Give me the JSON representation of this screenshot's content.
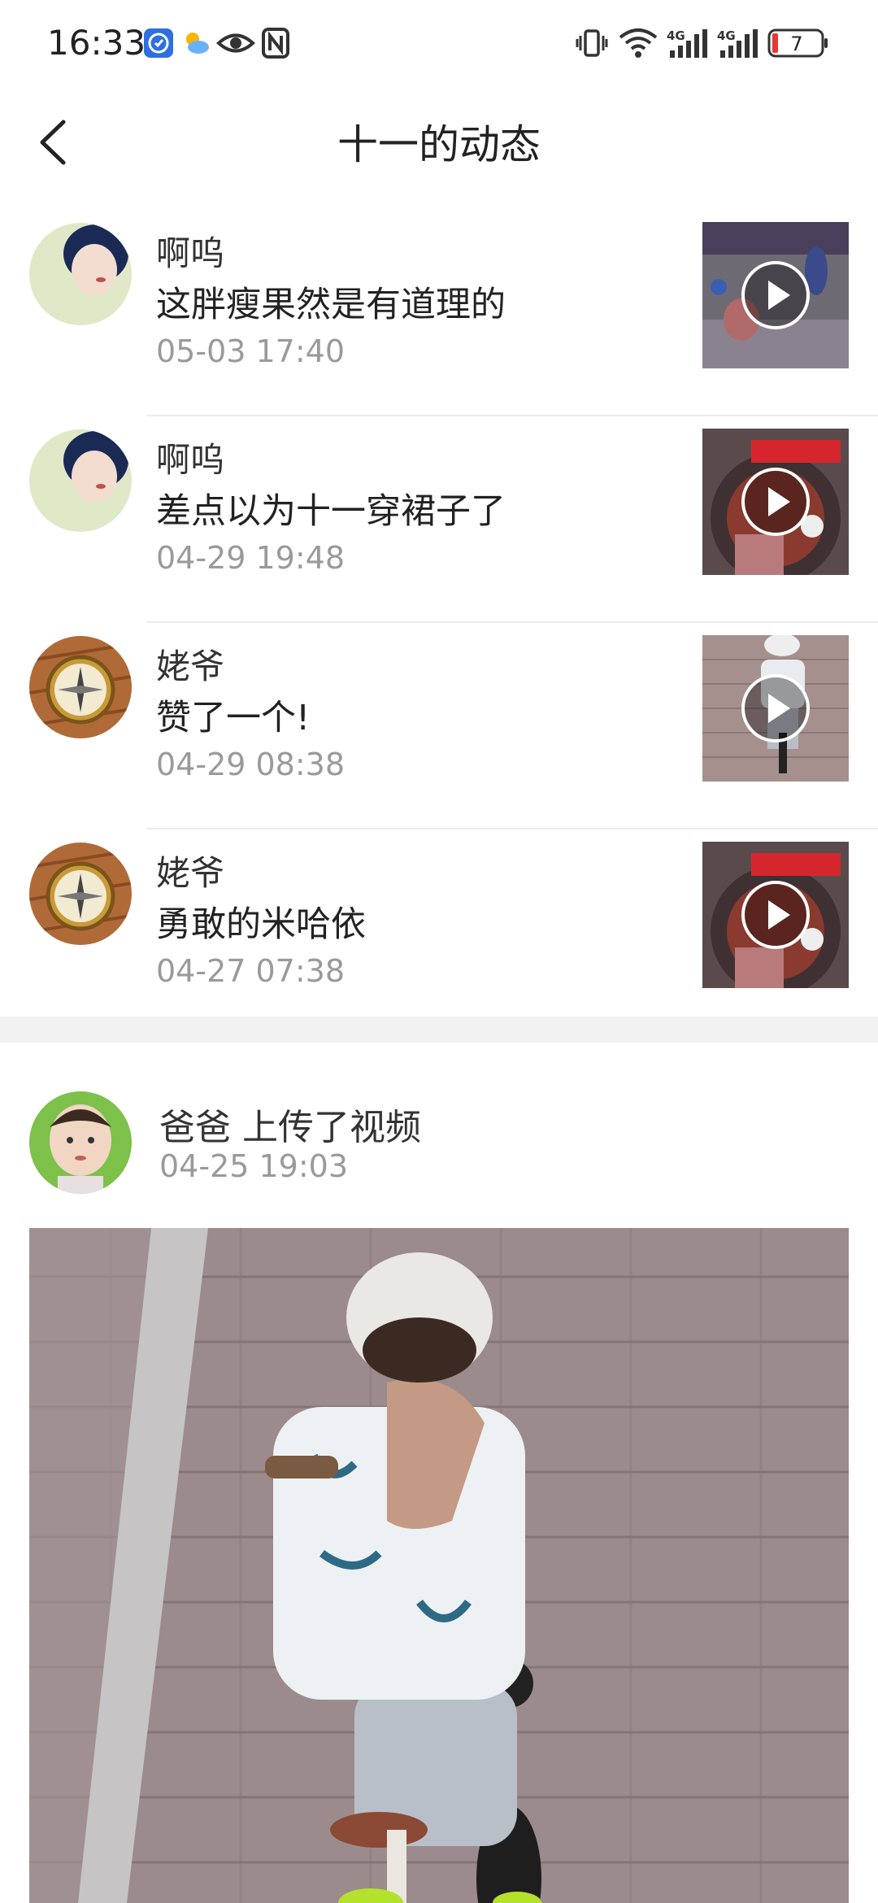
{
  "status_bar": {
    "time": "16:33",
    "battery_level": "7",
    "signal_1": "4G",
    "signal_2": "4G",
    "icons": [
      "app-shield-icon",
      "weather-icon",
      "eye-icon",
      "nfc-icon",
      "vibrate-icon",
      "wifi-icon",
      "signal-icon",
      "battery-icon"
    ]
  },
  "header": {
    "title": "十一的动态"
  },
  "feed": [
    {
      "name": "啊呜",
      "message": "这胖瘦果然是有道理的",
      "time": "05-03 17:40"
    },
    {
      "name": "啊呜",
      "message": "差点以为十一穿裙子了",
      "time": "04-29 19:48"
    },
    {
      "name": "姥爷",
      "message": "赞了一个!",
      "time": "04-29 08:38"
    },
    {
      "name": "姥爷",
      "message": "勇敢的米哈依",
      "time": "04-27 07:38"
    }
  ],
  "post": {
    "user_action": "爸爸 上传了视频",
    "time": "04-25 19:03"
  },
  "colors": {
    "text_primary": "#222222",
    "text_secondary": "#9a9a9a",
    "divider": "#ececec",
    "section_gap": "#f2f2f2",
    "battery_low": "#e53935"
  }
}
